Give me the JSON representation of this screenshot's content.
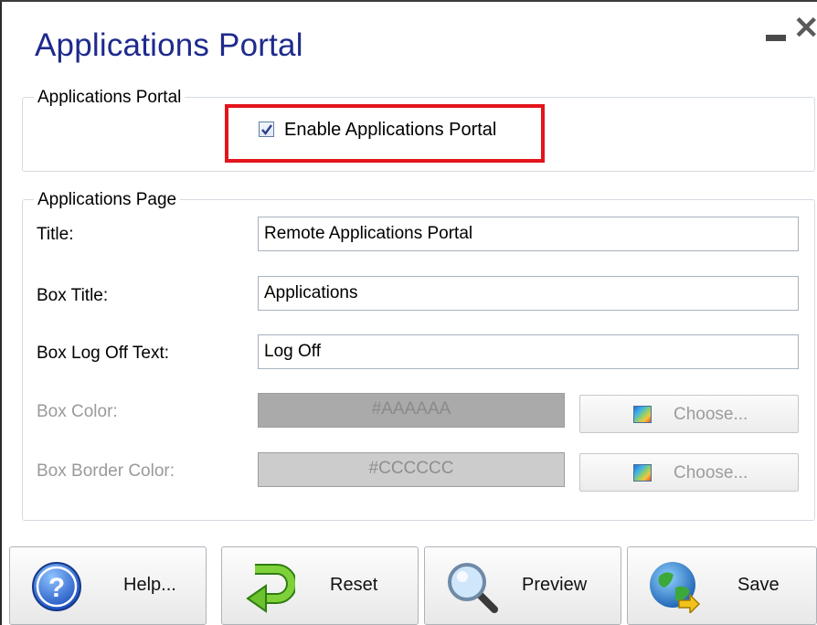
{
  "window": {
    "title": "Applications Portal"
  },
  "portal_group": {
    "legend": "Applications Portal",
    "enable_label": "Enable Applications Portal",
    "enable_checked": true
  },
  "page_group": {
    "legend": "Applications Page",
    "fields": [
      {
        "label": "Title:",
        "value": "Remote Applications Portal"
      },
      {
        "label": "Box Title:",
        "value": "Applications"
      },
      {
        "label": "Box Log Off Text:",
        "value": "Log Off"
      }
    ],
    "colors": [
      {
        "label": "Box Color:",
        "value": "#AAAAAA",
        "choose_label": "Choose...",
        "enabled": false
      },
      {
        "label": "Box Border Color:",
        "value": "#CCCCCC",
        "choose_label": "Choose...",
        "enabled": false
      }
    ]
  },
  "buttons": {
    "help": "Help...",
    "reset": "Reset",
    "preview": "Preview",
    "save": "Save"
  },
  "theme": {
    "title_color": "#1e2a8c",
    "highlight_color": "#e3141b"
  }
}
